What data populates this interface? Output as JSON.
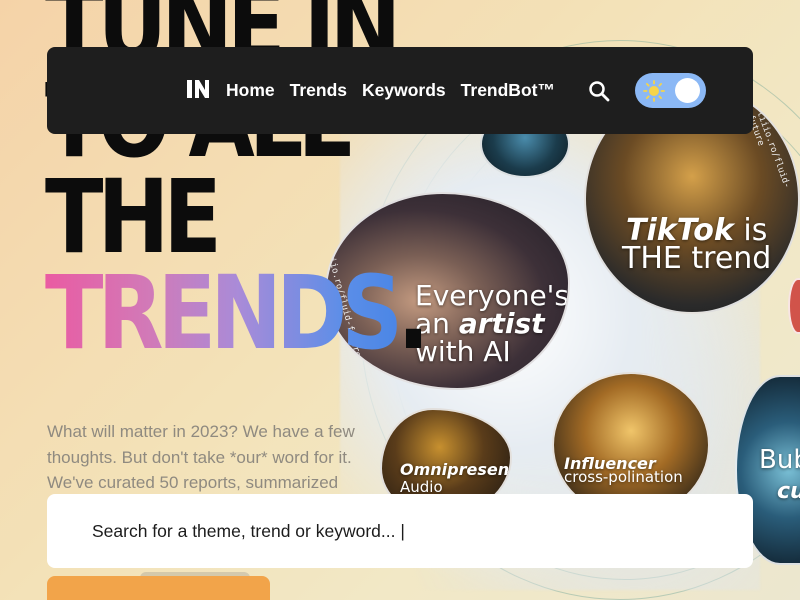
{
  "headline": {
    "lines": [
      "TUNE IN",
      "TO ALL",
      "THE"
    ],
    "highlight": "TRENDS",
    "punctuation": "."
  },
  "intro": {
    "text": "What will matter in 2023? We have a few thoughts. But don't take *our* word for it. We've curated 50 reports, summarized"
  },
  "nav": {
    "logo_label": "IN",
    "links": [
      "Home",
      "Trends",
      "Keywords",
      "TrendBot™"
    ],
    "search_icon": "search-icon",
    "theme_toggle": {
      "state": "light",
      "icon": "sun-icon"
    }
  },
  "search": {
    "placeholder": "Search for a theme, trend or keyword... |"
  },
  "collage": {
    "url_tag": "tiiio.ro/fluid-future",
    "cards": {
      "artist": {
        "line1": "Everyone's",
        "line2_prefix": "an ",
        "line2_emph": "artist",
        "line3": "with AI"
      },
      "tiktok": {
        "emph": "TikTok",
        "rest1": " is",
        "line2": "THE trend"
      },
      "omni": {
        "emph": "Omnipresent",
        "line2": "Audio"
      },
      "influ": {
        "emph": "Influencer",
        "line2": "cross-polination"
      },
      "bub": {
        "line1": "Bub",
        "line2": "cu"
      }
    }
  },
  "colors": {
    "navbar": "#1e1e1e",
    "toggle": "#8bb8f5",
    "cta": "#f2a44a",
    "gradient_start": "#ea5ba2",
    "gradient_end": "#4b86e6"
  }
}
